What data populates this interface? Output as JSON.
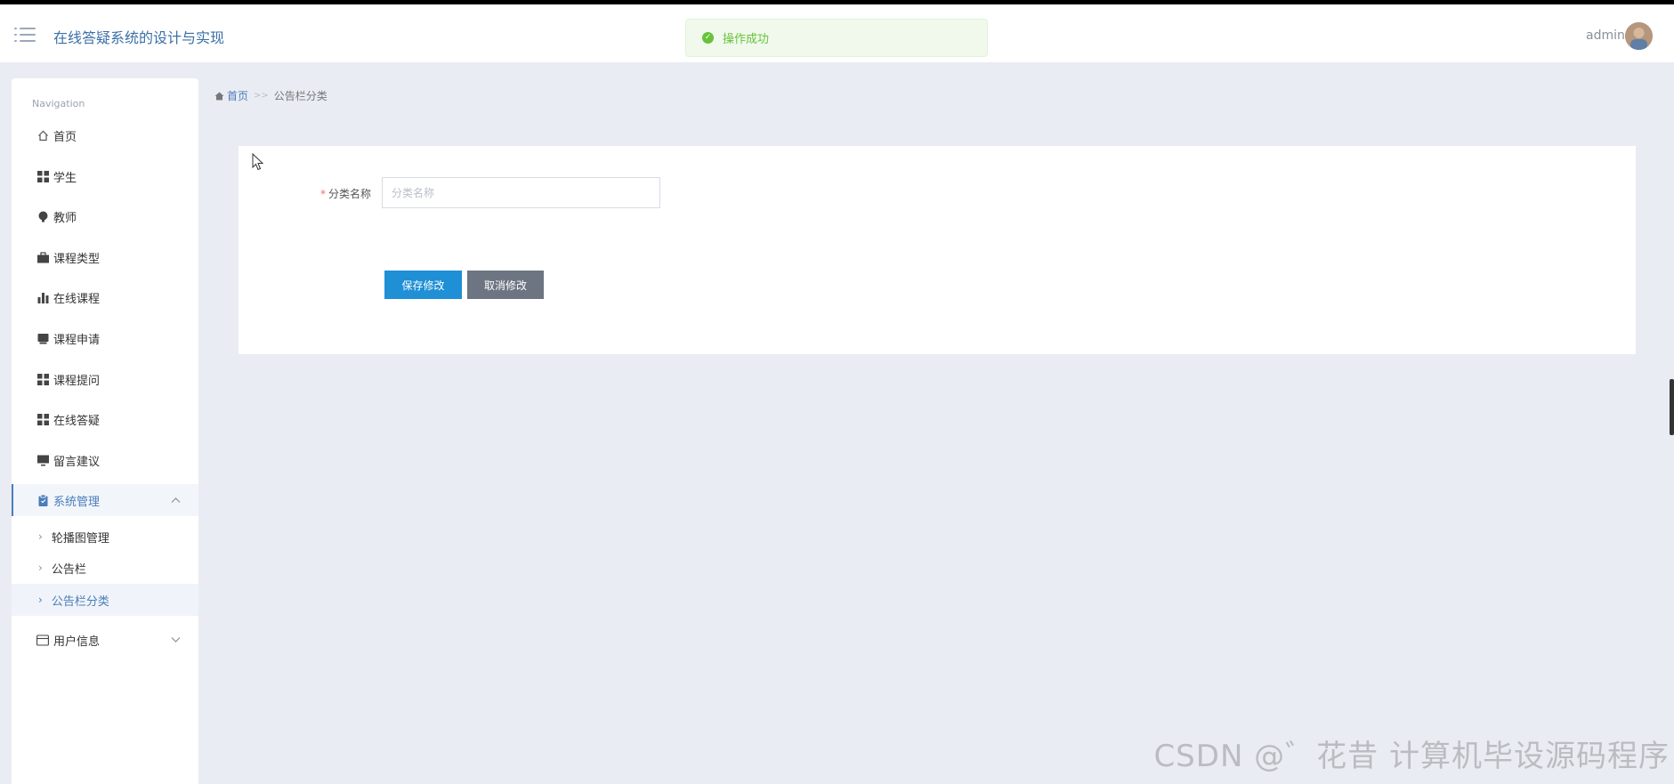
{
  "header": {
    "app_title": "在线答疑系统的设计与实现",
    "user_name": "admin",
    "toast": "操作成功"
  },
  "sidebar": {
    "caption": "Navigation",
    "items": [
      {
        "label": "首页",
        "icon": "home-icon"
      },
      {
        "label": "学生",
        "icon": "grid-icon"
      },
      {
        "label": "教师",
        "icon": "bulb-icon"
      },
      {
        "label": "课程类型",
        "icon": "briefcase-icon"
      },
      {
        "label": "在线课程",
        "icon": "bar-chart-icon"
      },
      {
        "label": "课程申请",
        "icon": "tray-icon"
      },
      {
        "label": "课程提问",
        "icon": "grid-icon"
      },
      {
        "label": "在线答疑",
        "icon": "grid-icon"
      },
      {
        "label": "留言建议",
        "icon": "monitor-icon"
      },
      {
        "label": "系统管理",
        "icon": "clipboard-icon"
      },
      {
        "label": "用户信息",
        "icon": "card-icon"
      }
    ],
    "sub_items": [
      {
        "label": "轮播图管理"
      },
      {
        "label": "公告栏"
      },
      {
        "label": "公告栏分类"
      }
    ]
  },
  "breadcrumb": {
    "home": "首页",
    "separator": ">>",
    "current": "公告栏分类"
  },
  "form": {
    "required_mark": "*",
    "field_label": "分类名称",
    "field_placeholder": "分类名称",
    "field_value": "",
    "save_label": "保存修改",
    "cancel_label": "取消修改"
  },
  "watermark": "CSDN @゛花昔 计算机毕设源码程序",
  "colors": {
    "accent": "#1f8fd6",
    "sidebar_active": "#4a7cb8",
    "success": "#67c23a",
    "background": "#e9ecf3"
  }
}
